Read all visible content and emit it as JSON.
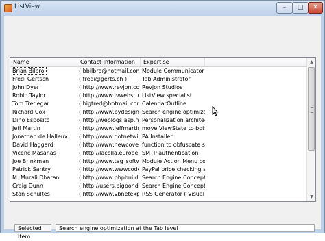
{
  "window": {
    "title": "ListView",
    "minimize_glyph": "–",
    "maximize_glyph": "□",
    "close_glyph": "✕"
  },
  "listview": {
    "columns": [
      "Name",
      "Contact Information",
      "Expertise"
    ],
    "rows": [
      {
        "name": "Brian Bilbro",
        "contact": "( bbilbro@hotmail.com )",
        "expertise": "Module Communicator co..."
      },
      {
        "name": "Fredi Gertsch",
        "contact": "( fredi@gerts.ch )",
        "expertise": "Tab Administrator"
      },
      {
        "name": "John Dyer",
        "contact": "( http://www.revjon.com)",
        "expertise": "Revjon Studios"
      },
      {
        "name": "Robin Taylor",
        "contact": "( http://www.lvwebstudio...",
        "expertise": "ListView specialist"
      },
      {
        "name": "Tom Tredegar",
        "contact": "( bigtred@hotmail.com )",
        "expertise": "CalendarOutline"
      },
      {
        "name": "Richard Cox",
        "contact": "( http://www.bydesignwe...",
        "expertise": "Search engine optimizati..."
      },
      {
        "name": "Dino Esposito",
        "contact": "( http://weblogs.asp.net/...",
        "expertise": "Personalization architectu..."
      },
      {
        "name": "Jeff Martin",
        "contact": "( http://www.jeffmartin.com...",
        "expertise": "move ViewState to botto..."
      },
      {
        "name": "Jonathan de Halleux",
        "contact": "( http://www.dotnetwiki.o...",
        "expertise": "PA Installer"
      },
      {
        "name": "David Haggard",
        "contact": "( http://www.newcovena...",
        "expertise": "function to obfuscate sen..."
      },
      {
        "name": "Vicenc Masanas",
        "contact": "( http://lacolla.europe.w...",
        "expertise": "SMTP authentication"
      },
      {
        "name": "Joe Brinkman",
        "contact": "( http://www.tag_softwar...",
        "expertise": "Module Action Menu con..."
      },
      {
        "name": "Patrick Santry",
        "contact": "( http://www.wwwcoder.c...",
        "expertise": "PayPal price checking an..."
      },
      {
        "name": "M. Murali Dharan",
        "contact": "( http://www.phpbuilder...",
        "expertise": "Search Engine Concepts"
      },
      {
        "name": "Craig Dunn",
        "contact": "( http://users.bigpond.c...",
        "expertise": "Search Engine Concepts"
      },
      {
        "name": "Stan Schultes",
        "contact": "( http://www.vbnetexpert...",
        "expertise": " RSS Generator ( Visual ..."
      }
    ]
  },
  "selected_item": {
    "label": "Selected Item:",
    "value": "Search engine optimization at the Tab level"
  },
  "scrollbar": {
    "up_glyph": "▲",
    "down_glyph": "▼"
  }
}
